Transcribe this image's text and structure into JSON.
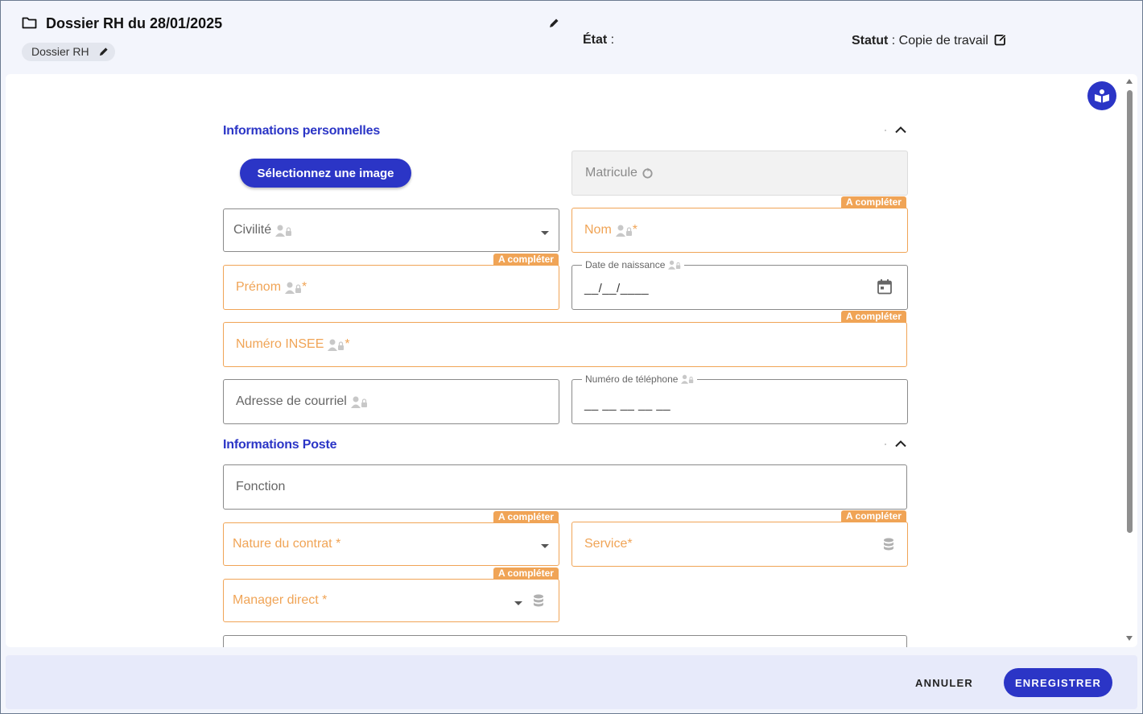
{
  "header": {
    "title": "Dossier RH du 28/01/2025",
    "chip": "Dossier RH",
    "etat_label": "État",
    "etat_sep": " :",
    "statut_label": "Statut",
    "statut_value": " : Copie de travail"
  },
  "sections": {
    "personal": "Informations personnelles",
    "poste": "Informations Poste"
  },
  "image_button": "Sélectionnez une image",
  "badge_text": "A compléter",
  "fields": {
    "matricule": "Matricule",
    "civilite": "Civilité",
    "nom": "Nom",
    "prenom": "Prénom",
    "date_naissance": "Date de naissance",
    "date_placeholder": "__/__/____",
    "insee": "Numéro INSEE",
    "courriel": "Adresse de courriel",
    "telephone": "Numéro de téléphone",
    "telephone_placeholder": "__ __ __ __ __",
    "fonction": "Fonction",
    "nature_contrat": "Nature du contrat *",
    "service": "Service*",
    "manager": "Manager direct *",
    "required_mark": "*"
  },
  "footer": {
    "cancel": "ANNULER",
    "save": "ENREGISTRER"
  },
  "colors": {
    "accent": "#2b35c6",
    "required": "#f0a456"
  }
}
